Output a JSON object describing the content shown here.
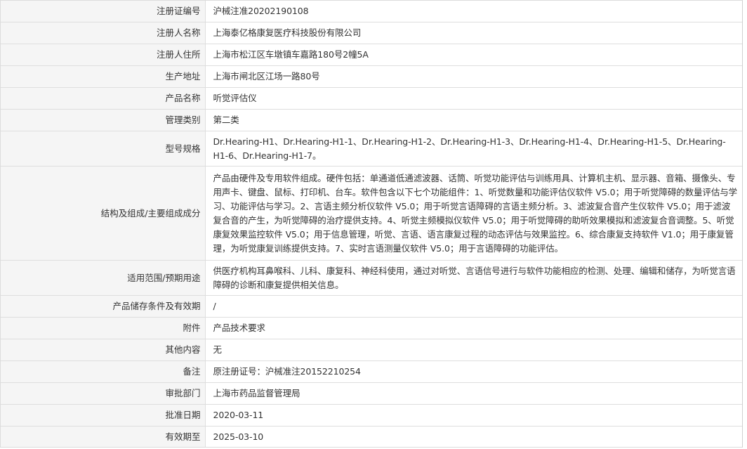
{
  "rows": [
    {
      "label": "注册证编号",
      "value": "沪械注准20202190108",
      "size": "h1"
    },
    {
      "label": "注册人名称",
      "value": "上海泰亿格康复医疗科技股份有限公司",
      "size": "h1"
    },
    {
      "label": "注册人住所",
      "value": "上海市松江区车墩镇车嘉路180号2幢5A",
      "size": "h1"
    },
    {
      "label": "生产地址",
      "value": "上海市闸北区江场一路80号",
      "size": "h1"
    },
    {
      "label": "产品名称",
      "value": "听觉评估仪",
      "size": "h1"
    },
    {
      "label": "管理类别",
      "value": "第二类",
      "size": "h1"
    },
    {
      "label": "型号规格",
      "value": "Dr.Hearing-H1、Dr.Hearing-H1-1、Dr.Hearing-H1-2、Dr.Hearing-H1-3、Dr.Hearing-H1-4、Dr.Hearing-H1-5、Dr.Hearing-H1-6、Dr.Hearing-H1-7。",
      "size": "h2"
    },
    {
      "label": "结构及组成/主要组成成分",
      "value": "产品由硬件及专用软件组成。硬件包括：单通道低通滤波器、话筒、听觉功能评估与训练用具、计算机主机、显示器、音箱、摄像头、专用声卡、键盘、鼠标、打印机、台车。软件包含以下七个功能组件：1、听觉数量和功能评估仪软件 V5.0；用于听觉障碍的数量评估与学习、功能评估与学习。2、言语主频分析仪软件 V5.0；用于听觉言语障碍的言语主频分析。3、滤波复合音产生仪软件 V5.0；用于滤波复合音的产生，为听觉障碍的治疗提供支持。4、听觉主频模拟仪软件 V5.0；用于听觉障碍的助听效果模拟和滤波复合音调整。5、听觉康复效果监控软件 V5.0；用于信息管理，听觉、言语、语言康复过程的动态评估与效果监控。6、综合康复支持软件 V1.0；用于康复管理，为听觉康复训练提供支持。7、实时言语测量仪软件 V5.0；用于言语障碍的功能评估。",
      "size": "h6"
    },
    {
      "label": "适用范围/预期用途",
      "value": "供医疗机构耳鼻喉科、儿科、康复科、神经科使用，通过对听觉、言语信号进行与软件功能相应的检测、处理、编辑和储存，为听觉言语障碍的诊断和康复提供相关信息。",
      "size": "h2"
    },
    {
      "label": "产品储存条件及有效期",
      "value": "/",
      "size": "h1"
    },
    {
      "label": "附件",
      "value": "产品技术要求",
      "size": "h1"
    },
    {
      "label": "其他内容",
      "value": "无",
      "size": "h1"
    },
    {
      "label": "备注",
      "value": "原注册证号：沪械准注20152210254",
      "size": "h1"
    },
    {
      "label": "审批部门",
      "value": "上海市药品监督管理局",
      "size": "h1"
    },
    {
      "label": "批准日期",
      "value": "2020-03-11",
      "size": "h1"
    },
    {
      "label": "有效期至",
      "value": "2025-03-10",
      "size": "h1"
    }
  ],
  "colors": {
    "label_background": "#f5f5f5",
    "border": "#dedede",
    "text": "#333333"
  }
}
